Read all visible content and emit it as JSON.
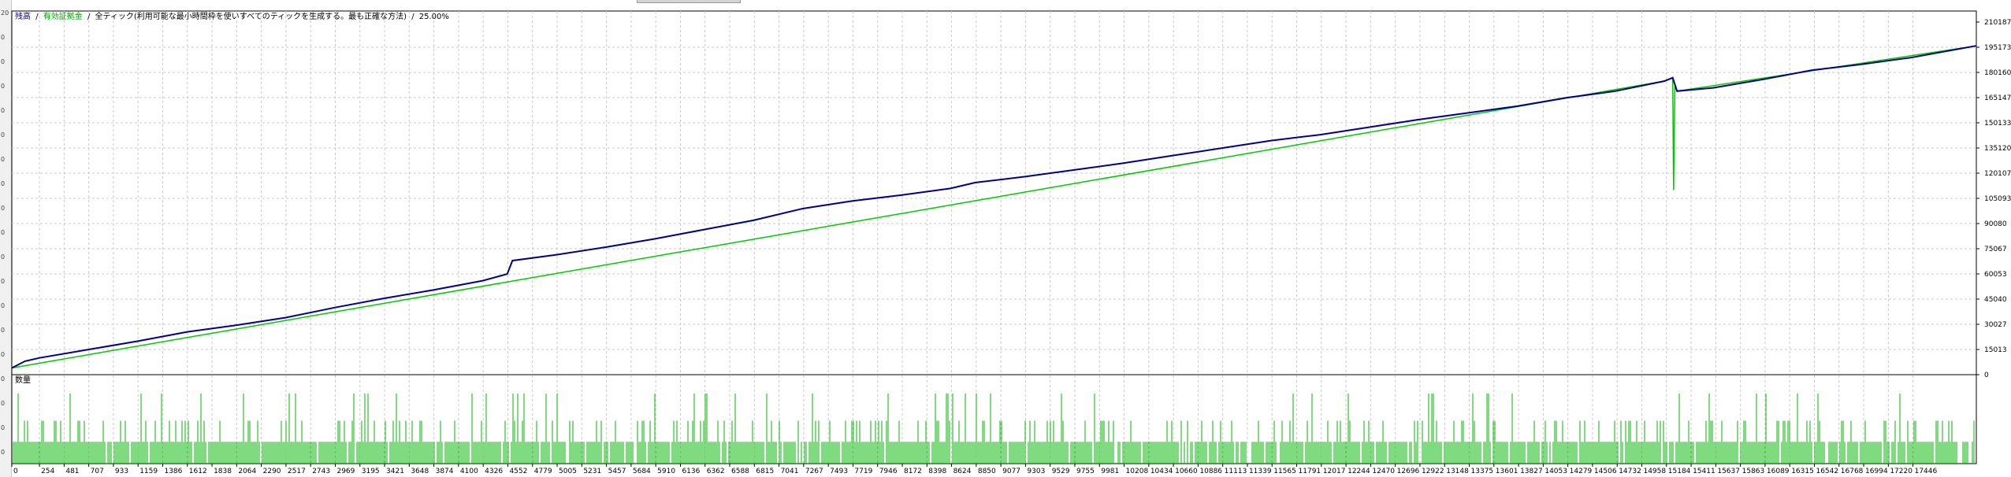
{
  "header": {
    "balance_label": "残高",
    "equity_label": "有効証拠金",
    "mode_text": "全ティック(利用可能な最小時間枠を使いすべてのティックを生成する。最も正確な方法)",
    "percent_text": "25.00%",
    "separator": "/"
  },
  "volume_panel": {
    "label": "数量"
  },
  "left_strip": {
    "ticks": [
      "20",
      "0",
      "0",
      "0",
      "0",
      "0",
      "0",
      "0",
      "0",
      "0",
      "0",
      "0",
      "0",
      "0",
      "0",
      "0",
      "0",
      "0",
      "0"
    ]
  },
  "colors": {
    "balance": "#00008b",
    "equity": "#00c800",
    "volume": "#00b400",
    "grid": "#c8c8c8",
    "frame": "#000000"
  },
  "chart_data": [
    {
      "type": "line",
      "title": "",
      "xlabel": "",
      "ylabel": "",
      "x_ticks": [
        "0",
        "254",
        "481",
        "707",
        "933",
        "1159",
        "1386",
        "1612",
        "1838",
        "2064",
        "2290",
        "2517",
        "2743",
        "2969",
        "3195",
        "3421",
        "3648",
        "3874",
        "4100",
        "4326",
        "4552",
        "4779",
        "5005",
        "5231",
        "5457",
        "5684",
        "5910",
        "6136",
        "6362",
        "6588",
        "6815",
        "7041",
        "7267",
        "7493",
        "7719",
        "7946",
        "8172",
        "8398",
        "8624",
        "8850",
        "9077",
        "9303",
        "9529",
        "9755",
        "9981",
        "10208",
        "10434",
        "10660",
        "10886",
        "11113",
        "11339",
        "11565",
        "11791",
        "12017",
        "12244",
        "12470",
        "12696",
        "12922",
        "13148",
        "13375",
        "13601",
        "13827",
        "14053",
        "14279",
        "14506",
        "14732",
        "14958",
        "15184",
        "15411",
        "15637",
        "15863",
        "16089",
        "16315",
        "16542",
        "16768",
        "16994",
        "17220",
        "17446"
      ],
      "y_ticks": [
        "210187",
        "195173",
        "180160",
        "165147",
        "150133",
        "135120",
        "120107",
        "105093",
        "90080",
        "75067",
        "60053",
        "45040",
        "30027",
        "15013",
        "0"
      ],
      "xlim": [
        0,
        18050
      ],
      "ylim": [
        0,
        210187
      ],
      "grid": true,
      "series": [
        {
          "name": "残高",
          "x": [
            0,
            120,
            254,
            707,
            1159,
            1612,
            2064,
            2517,
            2969,
            3421,
            3874,
            4326,
            4552,
            4600,
            5005,
            5457,
            5910,
            6362,
            6815,
            7267,
            7719,
            8172,
            8624,
            8850,
            9303,
            9755,
            10208,
            10660,
            11113,
            11565,
            12017,
            12470,
            12922,
            13375,
            13827,
            14279,
            14732,
            15184,
            15260,
            15300,
            15637,
            16089,
            16542,
            16994,
            17446,
            18050
          ],
          "y": [
            4000,
            8000,
            10000,
            15000,
            20000,
            25500,
            29500,
            34000,
            40000,
            45500,
            50500,
            56000,
            60000,
            68000,
            71500,
            76000,
            81000,
            86500,
            92000,
            99000,
            103500,
            107000,
            111000,
            114500,
            118000,
            122000,
            126000,
            130500,
            135000,
            139500,
            143000,
            147500,
            152000,
            156000,
            160000,
            165000,
            169000,
            175000,
            177000,
            169000,
            171000,
            176000,
            181500,
            185000,
            189000,
            196000
          ]
        },
        {
          "name": "有効証拠金",
          "x": [
            0,
            15184,
            15260,
            15268,
            15280,
            15300,
            18050
          ],
          "y": [
            4000,
            175000,
            177000,
            110000,
            172000,
            169000,
            196000
          ]
        }
      ],
      "legend": "top-left"
    },
    {
      "type": "bar",
      "title": "数量",
      "note": "volume histogram below the main chart, same x axis",
      "ylim": [
        0,
        1
      ]
    }
  ]
}
